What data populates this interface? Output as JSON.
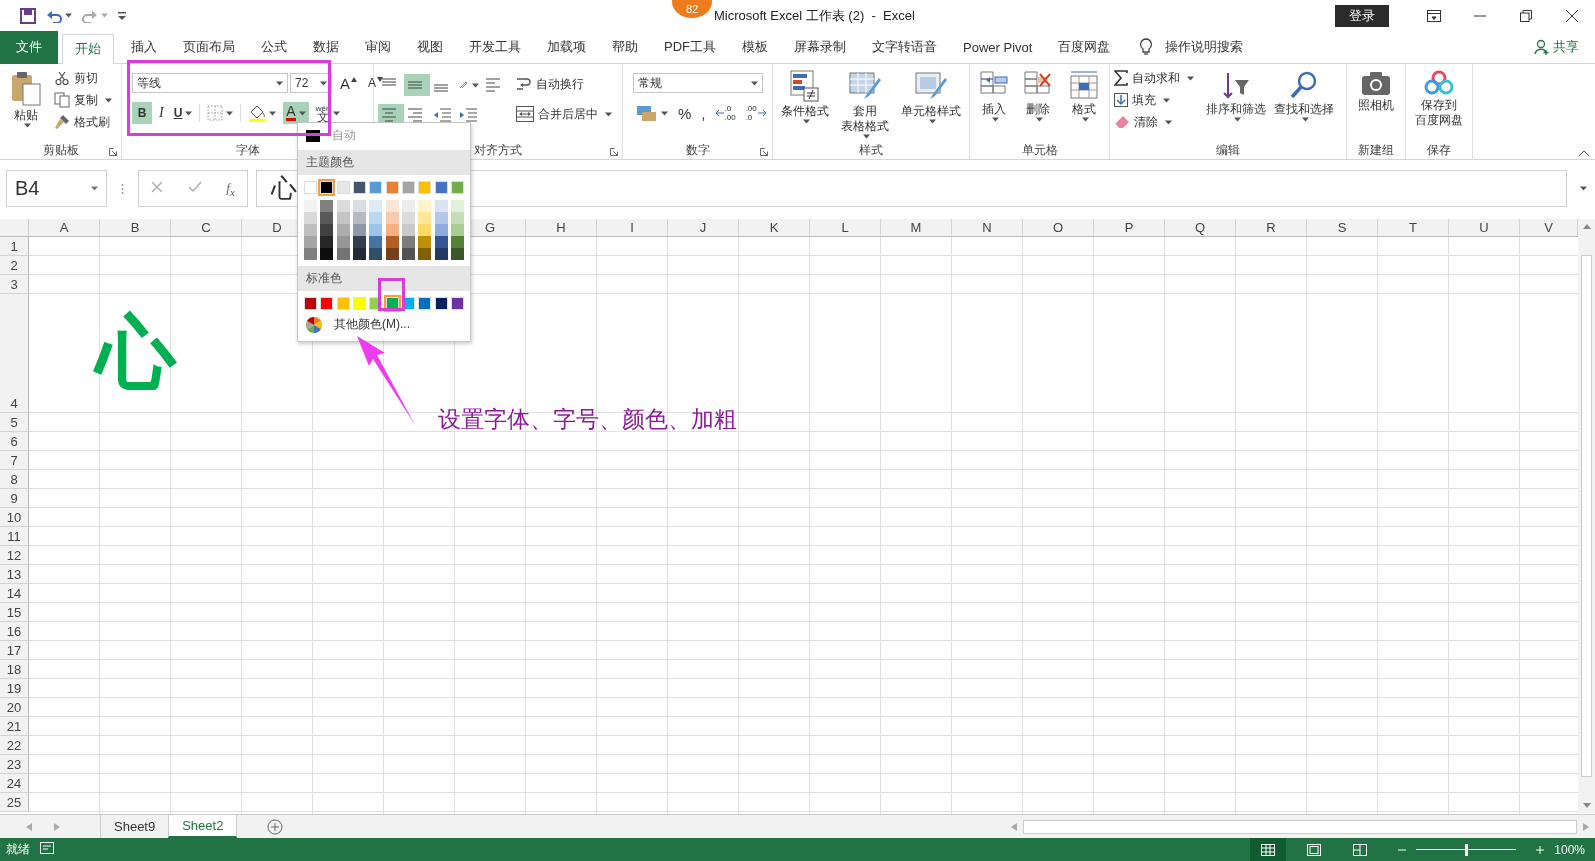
{
  "title": "Microsoft Excel 工作表 (2)  -  Excel",
  "badge": "82",
  "sign_in": "登录",
  "tabs": [
    {
      "label": "文件",
      "kind": "file",
      "selected": false
    },
    {
      "label": "开始",
      "kind": "tab",
      "selected": true
    },
    {
      "label": "插入",
      "kind": "tab",
      "selected": false
    },
    {
      "label": "页面布局",
      "kind": "tab",
      "selected": false
    },
    {
      "label": "公式",
      "kind": "tab",
      "selected": false
    },
    {
      "label": "数据",
      "kind": "tab",
      "selected": false
    },
    {
      "label": "审阅",
      "kind": "tab",
      "selected": false
    },
    {
      "label": "视图",
      "kind": "tab",
      "selected": false
    },
    {
      "label": "开发工具",
      "kind": "tab",
      "selected": false
    },
    {
      "label": "加载项",
      "kind": "tab",
      "selected": false
    },
    {
      "label": "帮助",
      "kind": "tab",
      "selected": false
    },
    {
      "label": "PDF工具",
      "kind": "tab",
      "selected": false
    },
    {
      "label": "模板",
      "kind": "tab",
      "selected": false
    },
    {
      "label": "屏幕录制",
      "kind": "tab",
      "selected": false
    },
    {
      "label": "文字转语音",
      "kind": "tab",
      "selected": false
    },
    {
      "label": "Power Pivot",
      "kind": "tab",
      "selected": false
    },
    {
      "label": "百度网盘",
      "kind": "tab",
      "selected": false
    }
  ],
  "tell_me": "操作说明搜索",
  "share": "共享",
  "clipboard": {
    "label": "剪贴板",
    "paste": "粘贴",
    "cut": "剪切",
    "copy": "复制",
    "format_painter": "格式刷"
  },
  "font": {
    "label": "字体",
    "name": "等线",
    "size": "72",
    "grow": "A",
    "shrink": "A",
    "bold_label": "B",
    "italic_label": "I",
    "underline_label": "U",
    "bold": true,
    "italic": false,
    "underline": false,
    "color_label": "A",
    "color_open": true,
    "phonetic_top": "wén",
    "phonetic": "文"
  },
  "alignment": {
    "label": "对齐方式",
    "buttons": [
      {
        "kind": "top",
        "selected": false
      },
      {
        "kind": "middle",
        "selected": true
      },
      {
        "kind": "bottom",
        "selected": false
      },
      {
        "kind": "left",
        "selected": false
      },
      {
        "kind": "center",
        "selected": true
      },
      {
        "kind": "right",
        "selected": false
      }
    ],
    "wrap": "自动换行",
    "merge": "合并后居中"
  },
  "number": {
    "label": "数字",
    "format": "常规",
    "percent": "%",
    "comma": ",",
    "increase_decimal": [
      ".0",
      ".00"
    ],
    "decrease_decimal": [
      ".00",
      ".0"
    ]
  },
  "styles": {
    "label": "样式",
    "buttons": [
      {
        "kind": "conditional",
        "lines": [
          "条件格式"
        ]
      },
      {
        "kind": "table",
        "lines": [
          "套用",
          "表格格式"
        ]
      },
      {
        "kind": "cell",
        "lines": [
          "单元格样式"
        ]
      }
    ]
  },
  "cells": {
    "label": "单元格",
    "buttons": [
      {
        "kind": "insert",
        "label": "插入"
      },
      {
        "kind": "delete",
        "label": "删除"
      },
      {
        "kind": "format",
        "label": "格式"
      }
    ]
  },
  "editing": {
    "label": "编辑",
    "small": [
      {
        "kind": "sum",
        "label": "自动求和"
      },
      {
        "kind": "fill",
        "label": "填充"
      },
      {
        "kind": "clear",
        "label": "清除"
      }
    ],
    "large": [
      {
        "kind": "sort",
        "label": "排序和筛选"
      },
      {
        "kind": "find",
        "label": "查找和选择"
      }
    ]
  },
  "new_group": {
    "label": "新建组",
    "button": "照相机"
  },
  "save": {
    "label": "保存",
    "lines": [
      "保存到",
      "百度网盘"
    ]
  },
  "formula_bar": {
    "name_box": "B4",
    "fx": "f$_{x}$",
    "content": "心"
  },
  "columns": [
    "A",
    "B",
    "C",
    "D",
    null,
    null,
    "G",
    "H",
    "I",
    "J",
    "K",
    "L",
    "M",
    "N",
    "O",
    "P",
    "Q",
    "R",
    "S",
    "T",
    "U",
    "V"
  ],
  "rows": [
    {
      "label": "1"
    },
    {
      "label": "2"
    },
    {
      "label": "3"
    },
    {
      "label": "4",
      "cells": {
        "B": "心"
      }
    },
    {
      "label": "5"
    },
    {
      "label": "6"
    },
    {
      "label": "7"
    },
    {
      "label": "8"
    },
    {
      "label": "9"
    },
    {
      "label": "10"
    },
    {
      "label": "11"
    },
    {
      "label": "12"
    },
    {
      "label": "13"
    },
    {
      "label": "14"
    },
    {
      "label": "15"
    },
    {
      "label": "16"
    },
    {
      "label": "17"
    },
    {
      "label": "18"
    },
    {
      "label": "19"
    },
    {
      "label": "20"
    },
    {
      "label": "21"
    },
    {
      "label": "22"
    },
    {
      "label": "23"
    },
    {
      "label": "24"
    },
    {
      "label": "25"
    }
  ],
  "palette": {
    "auto": "自动",
    "theme_title": "主题颜色",
    "theme": [
      {
        "color": "#ffffff",
        "selected": false
      },
      {
        "color": "#000000",
        "selected": true
      },
      {
        "color": "#e7e6e6",
        "selected": false
      },
      {
        "color": "#44546a",
        "selected": false
      },
      {
        "color": "#5b9bd5",
        "selected": false
      },
      {
        "color": "#ed7d31",
        "selected": false
      },
      {
        "color": "#a5a5a5",
        "selected": false
      },
      {
        "color": "#ffc000",
        "selected": false
      },
      {
        "color": "#4472c4",
        "selected": false
      },
      {
        "color": "#70ad47",
        "selected": false
      }
    ],
    "standard_title": "标准色",
    "standard": [
      {
        "color": "#c00000",
        "selected": false
      },
      {
        "color": "#ff0000",
        "selected": false
      },
      {
        "color": "#ffc000",
        "selected": false
      },
      {
        "color": "#ffff00",
        "selected": false
      },
      {
        "color": "#92d050",
        "selected": false
      },
      {
        "color": "#00b050",
        "selected": true
      },
      {
        "color": "#00b0f0",
        "selected": false
      },
      {
        "color": "#0070c0",
        "selected": false
      },
      {
        "color": "#002060",
        "selected": false
      },
      {
        "color": "#7030a0",
        "selected": false
      }
    ],
    "more": "其他颜色(M)..."
  },
  "annotation": "设置字体、字号、颜色、加粗",
  "sheets": [
    {
      "name": "Sheet9",
      "selected": false
    },
    {
      "name": "Sheet2",
      "selected": true
    }
  ],
  "status": {
    "ready": "就绪",
    "views": [
      {
        "kind": "normal",
        "selected": true
      },
      {
        "kind": "layout",
        "selected": false
      },
      {
        "kind": "break",
        "selected": false
      }
    ],
    "zoom_slider": {
      "level": 0.5
    },
    "zoom": "100%"
  }
}
